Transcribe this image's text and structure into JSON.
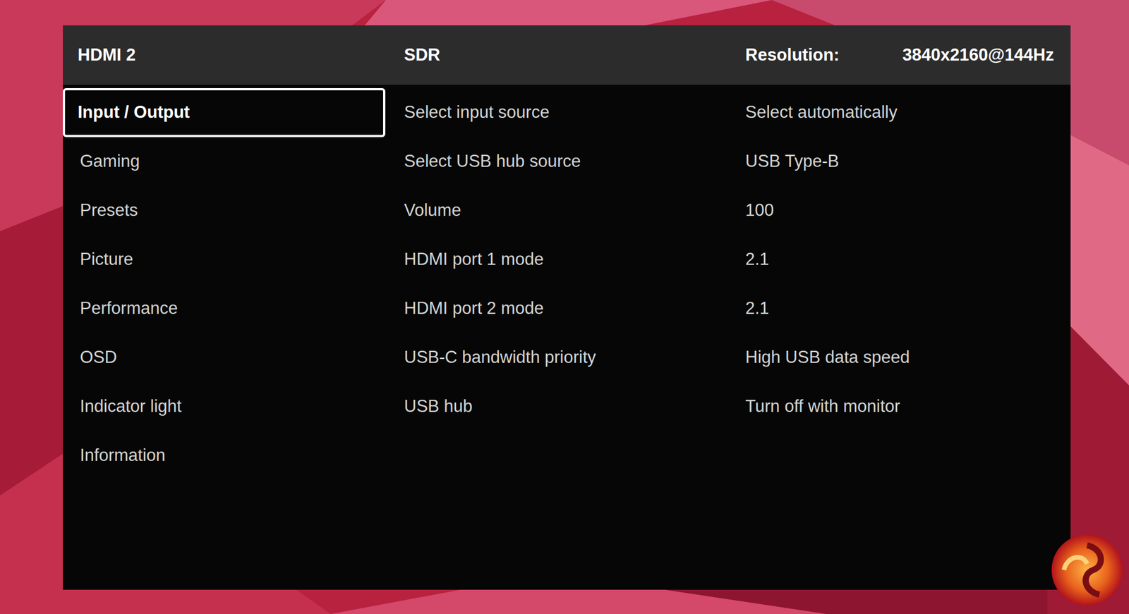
{
  "header": {
    "input": "HDMI 2",
    "mode": "SDR",
    "resolution_label": "Resolution:",
    "resolution": "3840x2160@144Hz"
  },
  "menu": [
    {
      "label": "Input / Output",
      "selected": true
    },
    {
      "label": "Gaming",
      "selected": false
    },
    {
      "label": "Presets",
      "selected": false
    },
    {
      "label": "Picture",
      "selected": false
    },
    {
      "label": "Performance",
      "selected": false
    },
    {
      "label": "OSD",
      "selected": false
    },
    {
      "label": "Indicator light",
      "selected": false
    },
    {
      "label": "Information",
      "selected": false
    }
  ],
  "settings": [
    {
      "label": "Select input source",
      "value": "Select automatically"
    },
    {
      "label": "Select USB hub source",
      "value": "USB Type-B"
    },
    {
      "label": "Volume",
      "value": "100"
    },
    {
      "label": "HDMI port 1 mode",
      "value": "2.1"
    },
    {
      "label": "HDMI port 2 mode",
      "value": "2.1"
    },
    {
      "label": "USB-C bandwidth priority",
      "value": "High USB data speed"
    },
    {
      "label": "USB hub",
      "value": "Turn off with monitor"
    }
  ]
}
